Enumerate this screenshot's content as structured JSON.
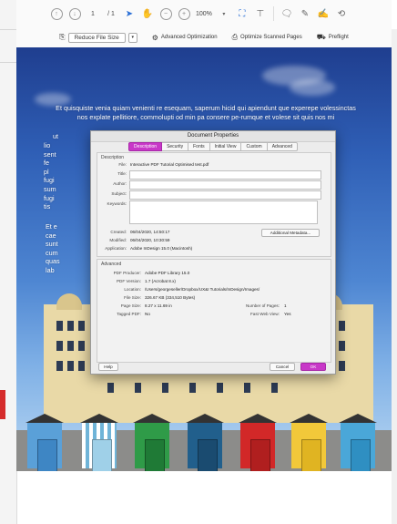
{
  "toolbar": {
    "page_current": "1",
    "page_total": "/ 1",
    "zoom": "100%"
  },
  "secondbar": {
    "reduce_label": "Reduce File Size",
    "advanced_label": "Advanced Optimization",
    "ocr_label": "Optimize Scanned Pages",
    "preflight_label": "Preflight"
  },
  "document": {
    "para1": "Et quisquiste venia quiam venienti re esequam, saperum hicid qui apiendunt que experepe volessinctas nos explate pellitiore, commolupti od min pa consere pe-rumque et volese sit quis nos mi",
    "para1_tail": "ut",
    "left_fragments": [
      "lio",
      "sent",
      "fe",
      "pl",
      "fugi",
      "sum",
      "fugi",
      "tis"
    ],
    "para2_start": "Et e",
    "left_fragments2": [
      "cae",
      "sunt",
      "cum",
      "quas",
      "lab"
    ],
    "colors": {
      "sky_top": "#1f3e8f",
      "sky_bottom": "#b9d7f2",
      "building": "#e9d9a7"
    }
  },
  "dialog": {
    "title": "Document Properties",
    "tabs": [
      "Description",
      "Security",
      "Fonts",
      "Initial View",
      "Custom",
      "Advanced"
    ],
    "active_tab": "Description",
    "description": {
      "group_label": "Description",
      "file_label": "File:",
      "file_value": "Interactive PDF Tutorial Optimised test.pdf",
      "title_label": "Title:",
      "title_value": "",
      "author_label": "Author:",
      "author_value": "",
      "subject_label": "Subject:",
      "subject_value": "",
      "keywords_label": "Keywords:",
      "keywords_value": "",
      "created_label": "Created:",
      "created_value": "06/04/2020, 14:50:17",
      "modified_label": "Modified:",
      "modified_value": "06/04/2020, 10:30:59",
      "application_label": "Application:",
      "application_value": "Adobe InDesign 15.0 (Macintosh)",
      "metadata_button": "Additional Metadata..."
    },
    "advanced": {
      "group_label": "Advanced",
      "producer_label": "PDF Producer:",
      "producer_value": "Adobe PDF Library 15.0",
      "version_label": "PDF Version:",
      "version_value": "1.7 (Acrobat 8.x)",
      "location_label": "Location:",
      "location_value": "/Users/georgeseller/Dropbox/UX&I Tutorials/InDesign/Images/",
      "filesize_label": "File Size:",
      "filesize_value": "326.67 KB (334,510 Bytes)",
      "pagesize_label": "Page Size:",
      "pagesize_value": "8.27 x 11.69 in",
      "pages_label": "Number of Pages:",
      "pages_value": "1",
      "tagged_label": "Tagged PDF:",
      "tagged_value": "No",
      "fastweb_label": "Fast Web View:",
      "fastweb_value": "Yes"
    },
    "help_button": "Help",
    "cancel_button": "Cancel",
    "ok_button": "OK",
    "accent": "#c838c8"
  }
}
